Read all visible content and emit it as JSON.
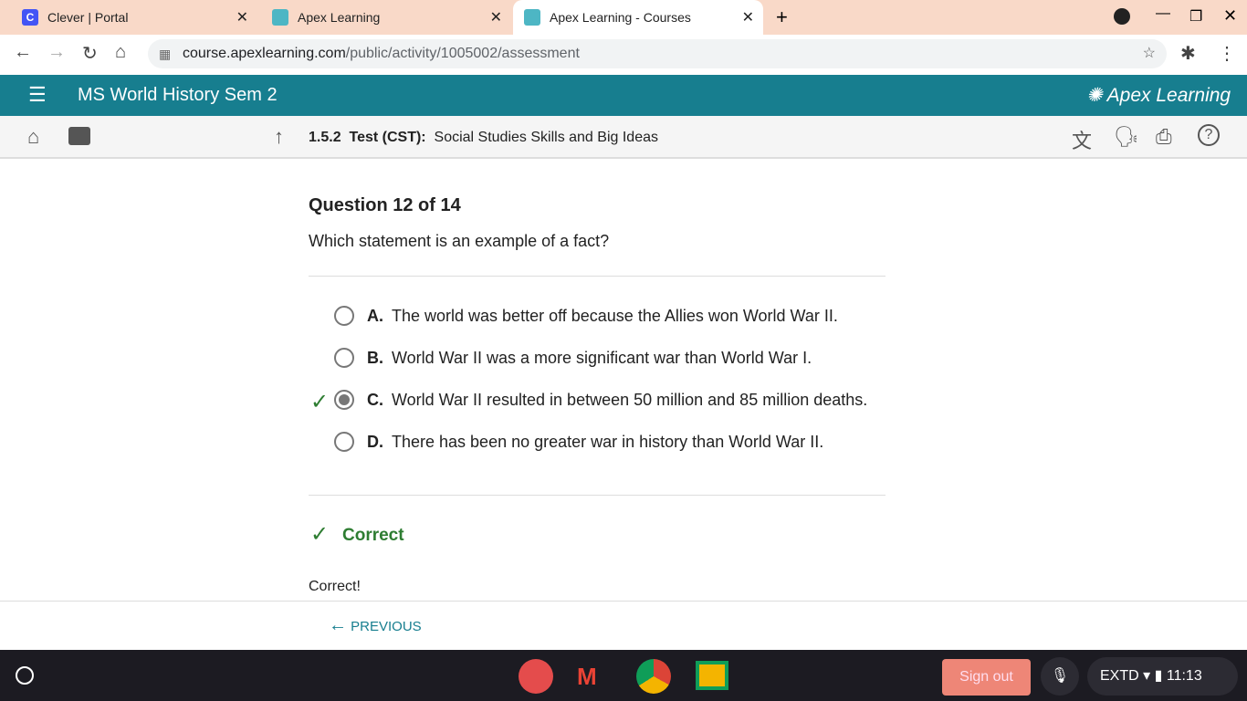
{
  "browser": {
    "tabs": [
      {
        "title": "Clever | Portal"
      },
      {
        "title": "Apex Learning"
      },
      {
        "title": "Apex Learning - Courses"
      }
    ],
    "url_host": "course.apexlearning.com",
    "url_path": "/public/activity/1005002/assessment"
  },
  "app": {
    "course_title": "MS World History Sem 2",
    "logo": "Apex Learning",
    "activity_number": "1.5.2",
    "activity_type": "Test (CST):",
    "activity_title": "Social Studies Skills and Big Ideas"
  },
  "question": {
    "counter": "Question 12 of 14",
    "prompt": "Which statement is an example of a fact?",
    "options": [
      {
        "letter": "A.",
        "text": "The world was better off because the Allies won World War II."
      },
      {
        "letter": "B.",
        "text": "World War II was a more significant war than World War I."
      },
      {
        "letter": "C.",
        "text": "World War II resulted in between 50 million and 85 million deaths.",
        "selected": true,
        "correct": true
      },
      {
        "letter": "D.",
        "text": "There has been no greater war in history than World War II."
      }
    ],
    "result": "Correct",
    "feedback": "Correct!"
  },
  "footer": {
    "previous": "PREVIOUS"
  },
  "shelf": {
    "sign_out": "Sign out",
    "status": "EXTD",
    "time": "11:13"
  },
  "colors": {
    "accent": "#177e8f",
    "correct": "#2e7d32"
  }
}
